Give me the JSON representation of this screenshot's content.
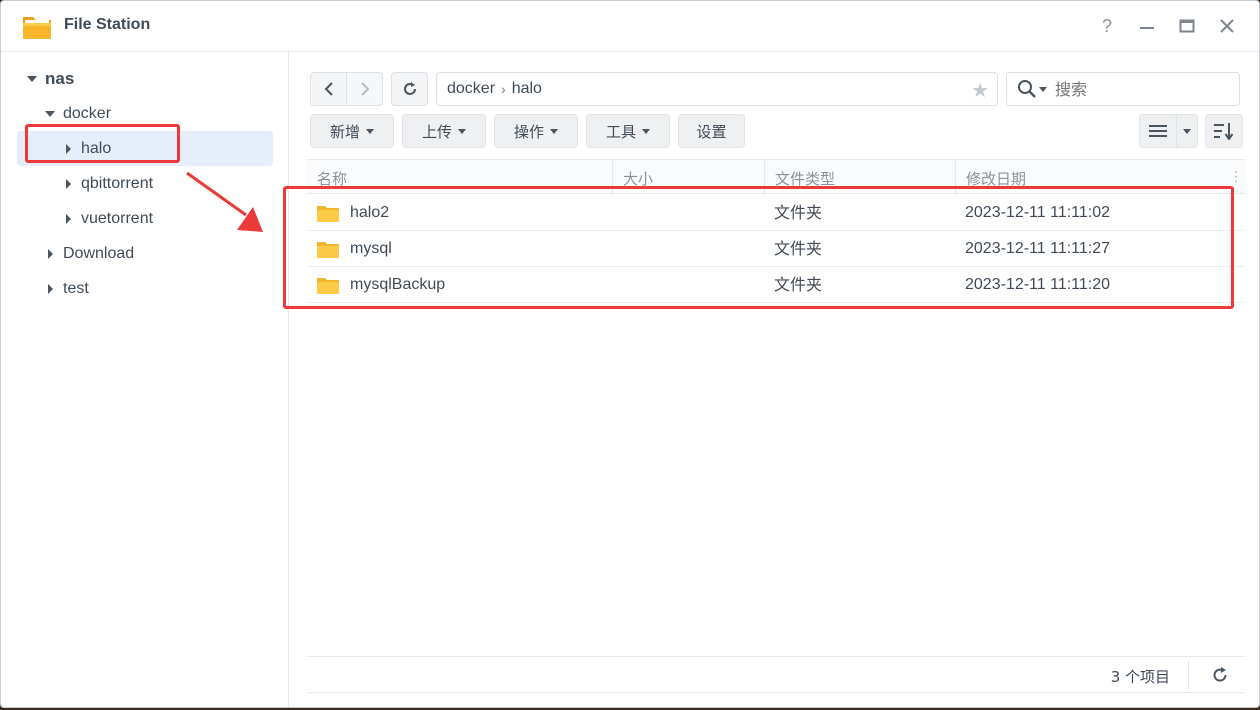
{
  "window": {
    "title": "File Station",
    "help_glyph": "?"
  },
  "sidebar": {
    "root": "nas",
    "items": [
      {
        "label": "docker"
      },
      {
        "label": "halo"
      },
      {
        "label": "qbittorrent"
      },
      {
        "label": "vuetorrent"
      },
      {
        "label": "Download"
      },
      {
        "label": "test"
      }
    ]
  },
  "toolbar": {
    "path": [
      "docker",
      "halo"
    ],
    "path_separator": "›",
    "search_placeholder": "搜索",
    "buttons": [
      "新增",
      "上传",
      "操作",
      "工具",
      "设置"
    ]
  },
  "table": {
    "columns": [
      "名称",
      "大小",
      "文件类型",
      "修改日期"
    ],
    "rows": [
      {
        "name": "halo2",
        "size": "",
        "type": "文件夹",
        "modified": "2023-12-11 11:11:02"
      },
      {
        "name": "mysql",
        "size": "",
        "type": "文件夹",
        "modified": "2023-12-11 11:11:27"
      },
      {
        "name": "mysqlBackup",
        "size": "",
        "type": "文件夹",
        "modified": "2023-12-11 11:11:20"
      }
    ]
  },
  "footer": {
    "item_count": "3 个项目"
  },
  "colors": {
    "annotation_red": "#ec3a3a",
    "selected_bg": "#e5eefa",
    "folder_yellow": "#f9c740"
  }
}
